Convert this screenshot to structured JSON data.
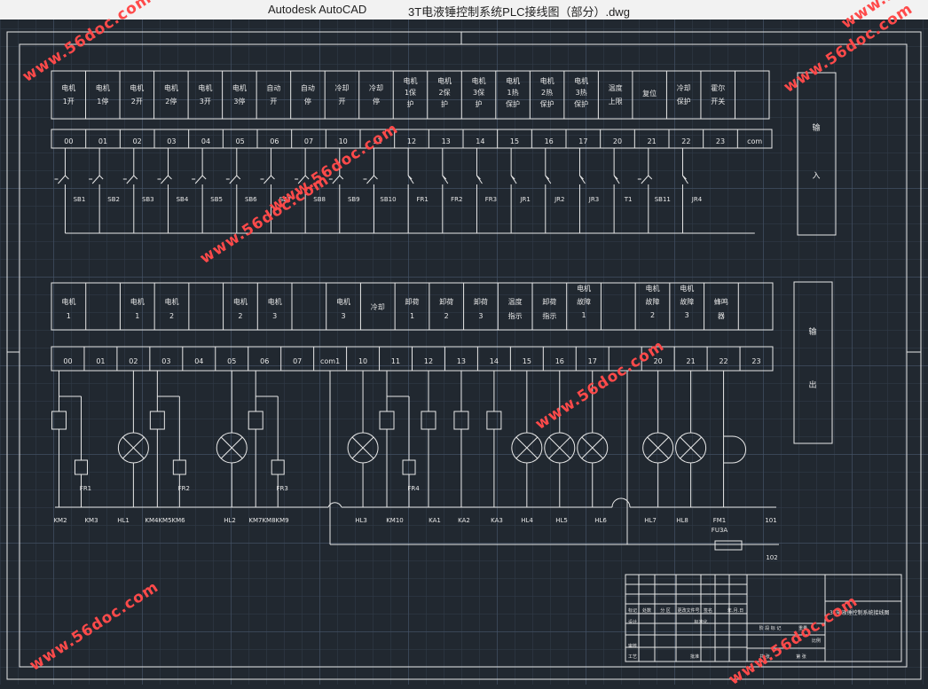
{
  "titlebar": {
    "app_name": "Autodesk AutoCAD",
    "document": "3T电液锤控制系统PLC接线图（部分）.dwg"
  },
  "watermark": "www.56doc.com",
  "colors": {
    "background": "#212830",
    "lines": "#e8e8e8",
    "watermark": "#ff4a4a"
  },
  "input_section": {
    "side_label_top": "输",
    "side_label_bottom": "入",
    "cells": [
      [
        "电机",
        "1开"
      ],
      [
        "电机",
        "1停"
      ],
      [
        "电机",
        "2开"
      ],
      [
        "电机",
        "2停"
      ],
      [
        "电机",
        "3开"
      ],
      [
        "电机",
        "3停"
      ],
      [
        "自动",
        "开"
      ],
      [
        "自动",
        "停"
      ],
      [
        "冷却",
        "开"
      ],
      [
        "冷却",
        "停"
      ],
      [
        "电机",
        "1保",
        "护"
      ],
      [
        "电机",
        "2保",
        "护"
      ],
      [
        "电机",
        "3保",
        "护"
      ],
      [
        "电机",
        "1热",
        "保护"
      ],
      [
        "电机",
        "2热",
        "保护"
      ],
      [
        "电机",
        "3热",
        "保护"
      ],
      [
        "温度",
        "上限"
      ],
      [
        "复位"
      ],
      [
        "冷却",
        "保护"
      ],
      [
        "霍尔",
        "开关"
      ],
      []
    ],
    "addresses": [
      "00",
      "01",
      "02",
      "03",
      "04",
      "05",
      "06",
      "07",
      "10",
      "11",
      "12",
      "13",
      "14",
      "15",
      "16",
      "17",
      "20",
      "21",
      "22",
      "23",
      "com"
    ],
    "devices": [
      "SB1",
      "SB2",
      "SB3",
      "SB4",
      "SB5",
      "SB6",
      "SB7",
      "SB8",
      "SB9",
      "SB10",
      "FR1",
      "FR2",
      "FR3",
      "JR1",
      "JR2",
      "JR3",
      "T1",
      "SB11",
      "JR4"
    ]
  },
  "output_section": {
    "side_label_top": "输",
    "side_label_bottom": "出",
    "cells": [
      [
        "电机",
        "1"
      ],
      [],
      [
        "电机",
        "1"
      ],
      [
        "电机",
        "2"
      ],
      [],
      [
        "电机",
        "2"
      ],
      [
        "电机",
        "3"
      ],
      [],
      [
        "电机",
        "3"
      ],
      [
        "冷却"
      ],
      [
        "卸荷",
        "1"
      ],
      [
        "卸荷",
        "2"
      ],
      [
        "卸荷",
        "3"
      ],
      [
        "温度",
        "指示"
      ],
      [
        "卸荷",
        "指示"
      ],
      [
        "电机",
        "故障",
        "1"
      ],
      [],
      [
        "电机",
        "故障",
        "2"
      ],
      [
        "电机",
        "故障",
        "3"
      ],
      [
        "蜂鸣",
        "器"
      ],
      []
    ],
    "addresses": [
      "00",
      "01",
      "02",
      "03",
      "04",
      "05",
      "06",
      "07",
      "com1",
      "10",
      "11",
      "12",
      "13",
      "14",
      "15",
      "16",
      "17",
      "",
      "20",
      "21",
      "22",
      "23"
    ],
    "protection_labels": [
      "FR1",
      "FR2",
      "FR3",
      "FR4"
    ],
    "bottom_labels": [
      "KM2",
      "KM3",
      "HL1",
      "KM4KM5KM6",
      "HL2",
      "KM7KM8KM9",
      "HL3",
      "KM10",
      "KA1",
      "KA2",
      "KA3",
      "HL4",
      "HL5",
      "HL6",
      "HL7",
      "HL8",
      "FM1",
      "101"
    ],
    "fuse_label": "FU3A",
    "node_102": "102"
  },
  "title_block": {
    "drawing_title": "3T电液锤控制系统接线图",
    "small_labels": [
      "标记",
      "处数",
      "分 区",
      "更改文件号",
      "签名",
      "年.月.日",
      "设计",
      "标准化",
      "审核",
      "工艺",
      "批准"
    ],
    "right_labels": [
      "阶 段 标 记",
      "重量",
      "比例"
    ],
    "sheet": [
      "共  张",
      "第  张"
    ]
  }
}
